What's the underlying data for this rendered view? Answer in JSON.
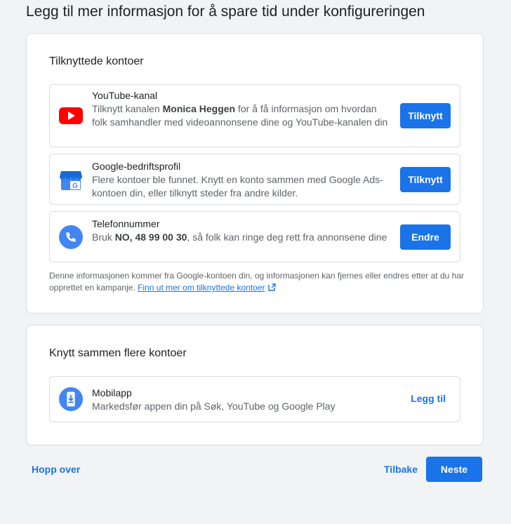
{
  "page": {
    "title": "Legg til mer informasjon for å spare tid under konfigureringen"
  },
  "linked_accounts": {
    "title": "Tilknyttede kontoer",
    "items": [
      {
        "icon": "youtube-icon",
        "title": "YouTube-kanal",
        "desc_pre": "Tilknytt kanalen ",
        "desc_bold": "Monica Heggen",
        "desc_post": " for å få informasjon om hvordan folk samhandler med videoannonsene dine og YouTube-kanalen din",
        "button": "Tilknytt"
      },
      {
        "icon": "google-business-profile-icon",
        "title": "Google-bedriftsprofil",
        "desc": "Flere kontoer ble funnet. Knytt en konto sammen med Google Ads-kontoen din, eller tilknytt steder fra andre kilder.",
        "button": "Tilknytt"
      },
      {
        "icon": "phone-icon",
        "title": "Telefonnummer",
        "desc_pre": "Bruk ",
        "desc_bold": "NO, 48 99 00 30",
        "desc_post": ", så folk kan ringe deg rett fra annonsene dine",
        "button": "Endre"
      }
    ],
    "footnote": "Denne informasjonen kommer fra Google-kontoen din, og informasjonen kan fjernes eller endres etter at du har opprettet en kampanje.",
    "footnote_link": "Finn ut mer om tilknyttede kontoer"
  },
  "more_accounts": {
    "title": "Knytt sammen flere kontoer",
    "items": [
      {
        "icon": "mobile-app-icon",
        "title": "Mobilapp",
        "desc": "Markedsfør appen din på Søk, YouTube og Google Play",
        "button": "Legg til"
      }
    ]
  },
  "footer": {
    "skip": "Hopp over",
    "back": "Tilbake",
    "next": "Neste"
  },
  "colors": {
    "accent": "#1a73e8",
    "youtube_red": "#ff0000",
    "background": "#f1f3f4"
  }
}
